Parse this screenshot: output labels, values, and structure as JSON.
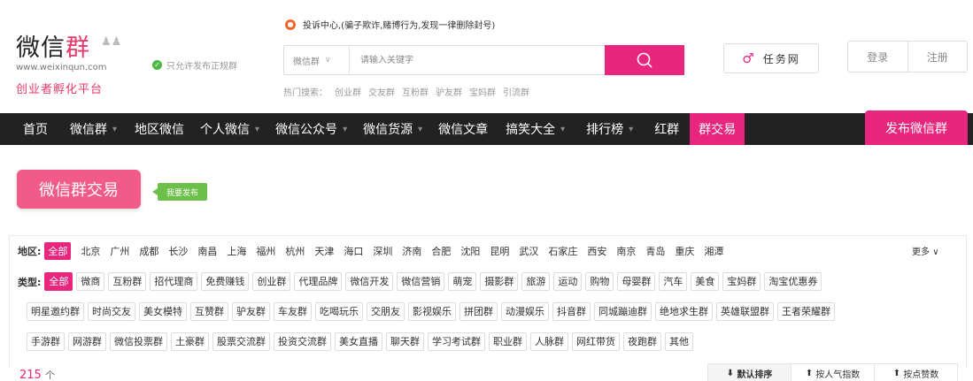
{
  "logo": {
    "main_left": "微信",
    "main_q": "群",
    "people": "♟♟",
    "url": "www.weixinqun.com",
    "slogan": "创业者孵化平台"
  },
  "verify": {
    "icon": "check-icon",
    "text": "只允许发布正规群"
  },
  "notice": {
    "icon": "alert-icon",
    "text": "投诉中心,(骗子欺诈,赌博行为,发现一律删除封号)"
  },
  "search": {
    "category": "微信群",
    "placeholder": "请输入关键字",
    "button_icon": "search-icon"
  },
  "hot": {
    "label": "热门搜索：",
    "terms": [
      "创业群",
      "交友群",
      "互粉群",
      "驴友群",
      "宝妈群",
      "引流群"
    ]
  },
  "task": {
    "icon": "task-icon",
    "label": "任务网"
  },
  "auth": {
    "login": "登录",
    "register": "注册"
  },
  "nav": {
    "items": [
      {
        "label": "首页",
        "arrow": false
      },
      {
        "label": "微信群",
        "arrow": true
      },
      {
        "label": "地区微信",
        "arrow": false
      },
      {
        "label": "个人微信",
        "arrow": true
      },
      {
        "label": "微信公众号",
        "arrow": true
      },
      {
        "label": "微信货源",
        "arrow": true
      },
      {
        "label": "微信文章",
        "arrow": false
      },
      {
        "label": "搞笑大全",
        "arrow": true
      },
      {
        "label": "排行榜",
        "arrow": true
      },
      {
        "label": "红群",
        "arrow": false
      },
      {
        "label": "群交易",
        "arrow": false,
        "active": true
      }
    ],
    "publish": "发布微信群"
  },
  "page": {
    "title": "微信群交易",
    "publish_tag": "我要发布"
  },
  "region": {
    "label": "地区:",
    "options": [
      "全部",
      "北京",
      "广州",
      "成都",
      "长沙",
      "南昌",
      "上海",
      "福州",
      "杭州",
      "天津",
      "海口",
      "深圳",
      "济南",
      "合肥",
      "沈阳",
      "昆明",
      "武汉",
      "石家庄",
      "西安",
      "南京",
      "青岛",
      "重庆",
      "湘潭"
    ],
    "selected": 0,
    "more": "更多"
  },
  "type": {
    "label": "类型:",
    "rows": [
      [
        "全部",
        "微商",
        "互粉群",
        "招代理商",
        "免费赚钱",
        "创业群",
        "代理品牌",
        "微信开发",
        "微信营销",
        "萌宠",
        "摄影群",
        "旅游",
        "运动",
        "购物",
        "母婴群",
        "汽车",
        "美食",
        "宝妈群",
        "淘宝优惠券"
      ],
      [
        "明星邀约群",
        "时尚交友",
        "美女模特",
        "互赞群",
        "驴友群",
        "车友群",
        "吃喝玩乐",
        "交朋友",
        "影视娱乐",
        "拼团群",
        "动漫娱乐",
        "抖音群",
        "同城蹦迪群",
        "绝地求生群",
        "英雄联盟群",
        "王者荣耀群"
      ],
      [
        "手游群",
        "网游群",
        "微信投票群",
        "土豪群",
        "股票交流群",
        "投资交流群",
        "美女直播",
        "聊天群",
        "学习考试群",
        "职业群",
        "人脉群",
        "网红带货",
        "夜跑群",
        "其他"
      ]
    ],
    "selected": "全部"
  },
  "results": {
    "count": "215",
    "unit": "个"
  },
  "sorts": [
    {
      "label": "默认排序",
      "icon": "arrow-down-icon",
      "active": true
    },
    {
      "label": "按人气指数",
      "icon": "arrow-up-icon",
      "active": false
    },
    {
      "label": "按点赞数",
      "icon": "arrow-up-icon",
      "active": false
    }
  ],
  "colors": {
    "accent": "#e9267d",
    "title_bg": "#f25a8a",
    "nav_bg": "#222222",
    "green": "#6cc04a"
  }
}
